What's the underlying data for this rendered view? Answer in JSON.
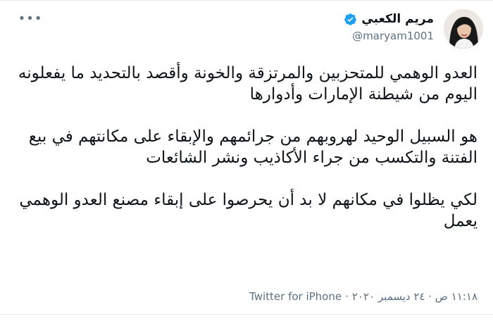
{
  "author": {
    "display_name": "مريم الكعبي",
    "username": "@maryam1001",
    "verified": true
  },
  "tweet": {
    "paragraphs": [
      "العدو الوهمي للمتحزبين والمرتزقة والخونة وأقصد بالتحديد ما يفعلونه اليوم من شيطنة الإمارات وأدوارها",
      "هو السبيل الوحيد لهروبهم من جرائمهم والإبقاء على مكانتهم في بيع الفتنة والتكسب من جراء الأكاذيب ونشر الشائعات",
      "لكي يظلوا في مكانهم لا بد أن يحرصوا على إبقاء مصنع العدو الوهمي يعمل"
    ],
    "timestamp": "١١:١٨ ص · ٢٤ ديسمبر ٢٠٢٠",
    "source": "Twitter for iPhone"
  },
  "controls": {
    "more_label": "•••"
  },
  "colors": {
    "verified": "#1da1f2",
    "secondary_text": "#5b7083",
    "divider": "#e6ecf0"
  },
  "icons": {
    "verified": "verified-badge-icon",
    "more": "more-options-icon"
  }
}
